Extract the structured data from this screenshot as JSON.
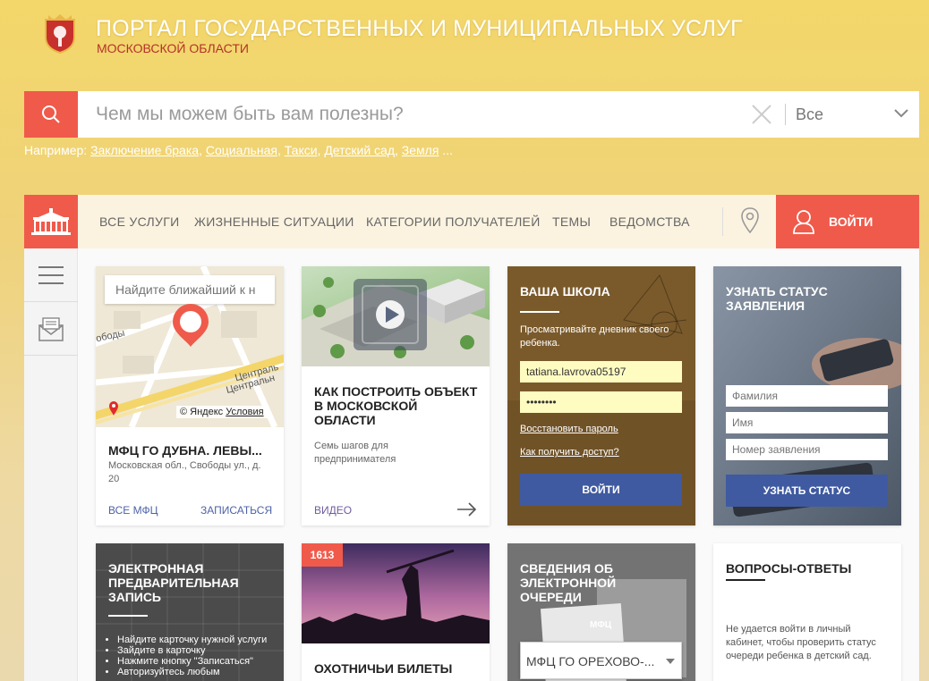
{
  "header": {
    "title": "ПОРТАЛ ГОСУДАРСТВЕННЫХ И МУНИЦИПАЛЬНЫХ УСЛУГ",
    "subtitle": "МОСКОВСКОЙ ОБЛАСТИ"
  },
  "search": {
    "placeholder": "Чем мы можем быть вам полезны?",
    "scope": "Все",
    "examples_label": "Например:",
    "examples": [
      "Заключение брака",
      "Социальная",
      "Такси",
      "Детский сад",
      "Земля"
    ],
    "examples_more": "..."
  },
  "nav": {
    "items": [
      "ВСЕ УСЛУГИ",
      "ЖИЗНЕННЫЕ СИТУАЦИИ",
      "КАТЕГОРИИ ПОЛУЧАТЕЛЕЙ",
      "ТЕМЫ",
      "ВЕДОМСТВА"
    ],
    "login": "ВОЙТИ"
  },
  "cards": {
    "mfc": {
      "map_placeholder": "Найдите ближайший к н",
      "street1": "ободы",
      "street2": "Централь",
      "street3": "Центральн",
      "yandex": "© Яндекс",
      "terms": "Условия",
      "title": "МФЦ ГО ДУБНА. ЛЕВЫ...",
      "address": "Московская обл., Свободы ул., д. 20",
      "all_link": "ВСЕ МФЦ",
      "signup_link": "ЗАПИСАТЬСЯ"
    },
    "build": {
      "title": "КАК ПОСТРОИТЬ ОБЪЕКТ В МОСКОВСКОЙ ОБЛАСТИ",
      "desc": "Семь шагов для предпринимателя",
      "video_link": "ВИДЕО"
    },
    "school": {
      "title": "ВАША ШКОЛА",
      "desc": "Просматривайте дневник своего ребенка.",
      "login_value": "tatiana.lavrova05197",
      "password_value": "••••••••",
      "restore": "Восстановить пароль",
      "access": "Как получить доступ?",
      "button": "ВОЙТИ"
    },
    "status": {
      "title": "УЗНАТЬ СТАТУС ЗАЯВЛЕНИЯ",
      "surname_ph": "Фамилия",
      "name_ph": "Имя",
      "number_ph": "Номер заявления",
      "button": "УЗНАТЬ СТАТУС"
    },
    "booking": {
      "title": "ЭЛЕКТРОННАЯ ПРЕДВАРИТЕЛЬНАЯ ЗАПИСЬ",
      "steps": [
        "Найдите карточку нужной услуги",
        "Зайдите в карточку",
        "Нажмите кнопку \"Записаться\"",
        "Авторизуйтесь любым"
      ]
    },
    "hunting": {
      "badge": "1613",
      "title": "ОХОТНИЧЬИ БИЛЕТЫ"
    },
    "queue": {
      "title": "СВЕДЕНИЯ ОБ ЭЛЕКТРОННОЙ ОЧЕРЕДИ",
      "ticket": "МФЦ",
      "select": "МФЦ ГО ОРЕХОВО-..."
    },
    "faq": {
      "title": "ВОПРОСЫ-ОТВЕТЫ",
      "text": "Не удается войти в личный кабинет, чтобы проверить статус очереди ребенка в детский сад."
    }
  },
  "colors": {
    "accent": "#f05a4b",
    "button_blue": "#3f5aa0",
    "subtitle_red": "#b5322a"
  }
}
